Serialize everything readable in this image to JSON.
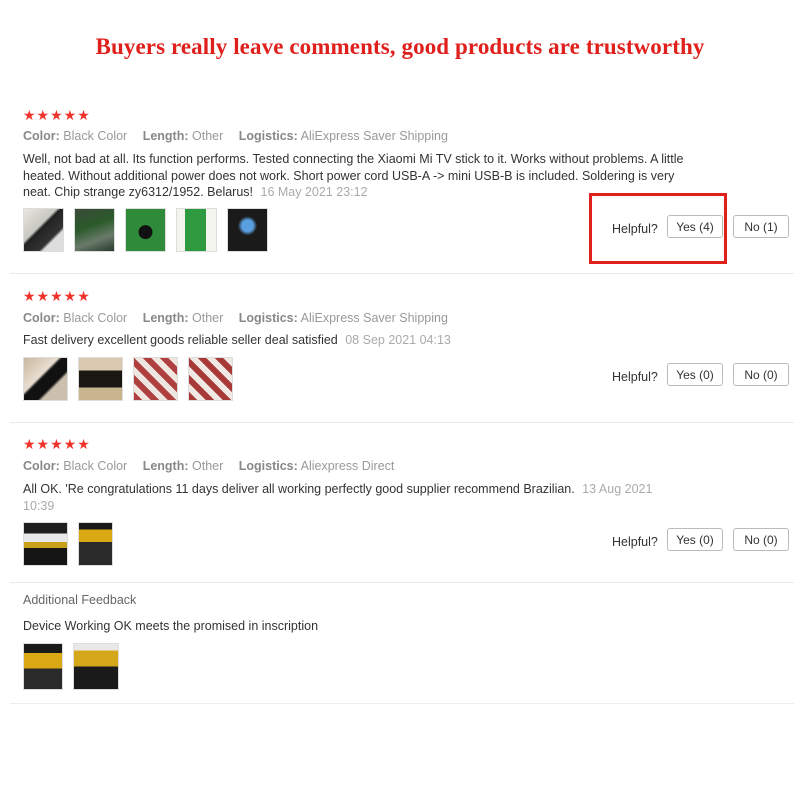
{
  "banner": "Buyers really leave comments, good products are trustworthy",
  "labels": {
    "color": "Color:",
    "length": "Length:",
    "logistics": "Logistics:",
    "helpful": "Helpful?",
    "additional_feedback": "Additional Feedback"
  },
  "reviews": [
    {
      "stars": "★★★★★",
      "rating": 5,
      "color": "Black Color",
      "length": "Other",
      "logistics": "AliExpress Saver Shipping",
      "text": "Well, not bad at all. Its function performs. Tested connecting the Xiaomi Mi TV stick to it. Works without problems. A little heated. Without additional power does not work. Short power cord USB-A -> mini USB-B is included. Soldering is very neat. Chip strange zy6312/1952. Belarus!",
      "date": "16 May 2021 23:12",
      "yes": "Yes (4)",
      "no": "No (1)",
      "thumb_count": 5
    },
    {
      "stars": "★★★★★",
      "rating": 5,
      "color": "Black Color",
      "length": "Other",
      "logistics": "AliExpress Saver Shipping",
      "text": "Fast delivery excellent goods reliable seller deal satisfied",
      "date": "08 Sep 2021 04:13",
      "yes": "Yes (0)",
      "no": "No (0)",
      "thumb_count": 4
    },
    {
      "stars": "★★★★★",
      "rating": 5,
      "color": "Black Color",
      "length": "Other",
      "logistics": "Aliexpress Direct",
      "text": "All OK. 'Re congratulations 11 days deliver all working perfectly good supplier recommend Brazilian.",
      "date": "13 Aug 2021 10:39",
      "yes": "Yes (0)",
      "no": "No (0)",
      "thumb_count": 2
    }
  ],
  "additional_feedback": {
    "text": "Device Working OK meets the promised in inscription",
    "thumb_count": 2
  },
  "colors": {
    "accent_red": "#e0201c",
    "star_red": "#f0332a"
  }
}
